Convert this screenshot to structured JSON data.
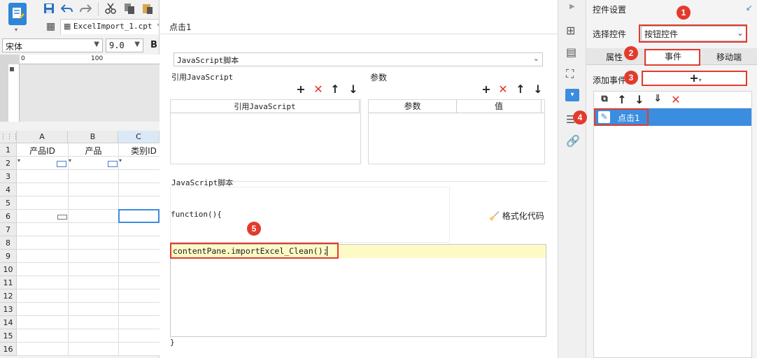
{
  "toolbar": {
    "file_tab": "ExcelImport_1.cpt *",
    "font_name": "宋体",
    "font_size": "9.0",
    "bold": "B"
  },
  "ruler": {
    "marks": [
      "0",
      "100"
    ]
  },
  "sheet": {
    "columns": [
      "A",
      "B",
      "C"
    ],
    "row_numbers": [
      "1",
      "2",
      "3",
      "4",
      "5",
      "6",
      "7",
      "8",
      "9",
      "10",
      "11",
      "12",
      "13",
      "14",
      "15",
      "16"
    ],
    "row1": [
      "产品ID",
      "产品",
      "类别ID"
    ]
  },
  "editor": {
    "title": "点击1",
    "script_type": "JavaScript脚本",
    "ref_js_label": "引用JavaScript",
    "params_label": "参数",
    "ref_js_col": "引用JavaScript",
    "param_cols": [
      "参数",
      "值"
    ],
    "script_label": "JavaScript脚本",
    "func_open": "function(){",
    "format_btn": "格式化代码",
    "code_line": "contentPane.importExcel_Clean();",
    "func_close": "}"
  },
  "panel": {
    "title": "控件设置",
    "select_label": "选择控件",
    "select_value": "按钮控件",
    "tabs": [
      "属性",
      "事件",
      "移动端"
    ],
    "add_event_label": "添加事件",
    "add_btn": "+",
    "event_item": "点击1",
    "badges": [
      "1",
      "2",
      "3",
      "4",
      "5"
    ]
  },
  "colors": {
    "accent": "#3b8ddf",
    "marker": "#e23b2e",
    "code_highlight": "#fdfac6"
  }
}
